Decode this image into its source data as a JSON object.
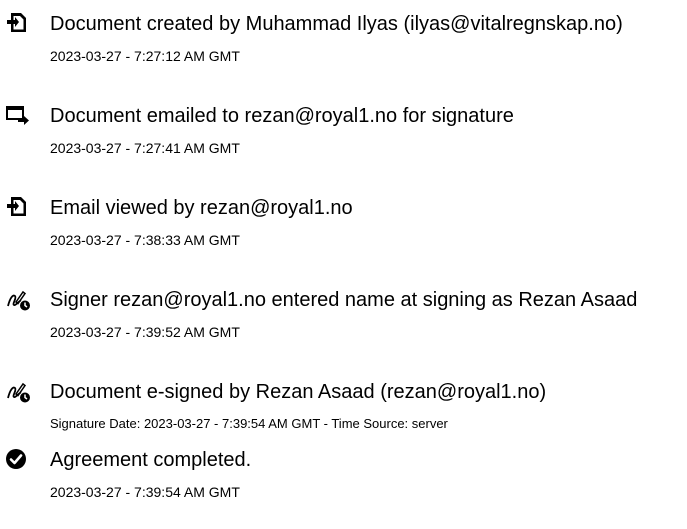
{
  "events": [
    {
      "icon": "document-icon",
      "title": "Document created by Muhammad Ilyas (ilyas@vitalregnskap.no)",
      "meta": "2023-03-27 - 7:27:12 AM GMT"
    },
    {
      "icon": "email-sent-icon",
      "title": "Document emailed to rezan@royal1.no for signature",
      "meta": "2023-03-27 - 7:27:41 AM GMT"
    },
    {
      "icon": "document-icon",
      "title": "Email viewed by rezan@royal1.no",
      "meta": "2023-03-27 - 7:38:33 AM GMT"
    },
    {
      "icon": "signature-pen-icon",
      "title": "Signer rezan@royal1.no entered name at signing as Rezan Asaad",
      "meta": "2023-03-27 - 7:39:52 AM GMT"
    },
    {
      "icon": "signature-pen-icon",
      "title": "Document e-signed by Rezan Asaad (rezan@royal1.no)",
      "meta": "Signature Date: 2023-03-27 - 7:39:54 AM GMT - Time Source: server"
    },
    {
      "icon": "check-circle-icon",
      "title": "Agreement completed.",
      "meta": "2023-03-27 - 7:39:54 AM GMT"
    }
  ]
}
